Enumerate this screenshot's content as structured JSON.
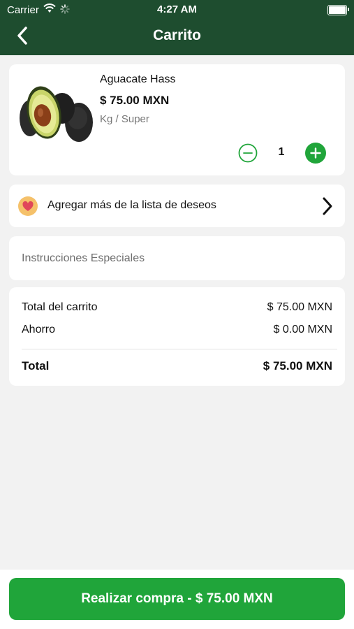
{
  "status_bar": {
    "carrier": "Carrier",
    "time": "4:27 AM"
  },
  "header": {
    "title": "Carrito",
    "back_icon": "chevron-left-icon"
  },
  "cart_item": {
    "name": "Aguacate Hass",
    "price": "$ 75.00 MXN",
    "unit": "Kg / Super",
    "quantity": "1"
  },
  "wishlist": {
    "label": "Agregar más de la lista de deseos"
  },
  "instructions": {
    "placeholder": "Instrucciones Especiales",
    "value": ""
  },
  "totals": {
    "cart_total_label": "Total del carrito",
    "cart_total_value": "$ 75.00 MXN",
    "savings_label": "Ahorro",
    "savings_value": "$ 0.00 MXN",
    "total_label": "Total",
    "total_value": "$ 75.00 MXN"
  },
  "checkout": {
    "label": "Realizar compra - $ 75.00 MXN"
  },
  "colors": {
    "header": "#1e4d2f",
    "accent": "#20a53a",
    "background": "#f2f2f2"
  }
}
